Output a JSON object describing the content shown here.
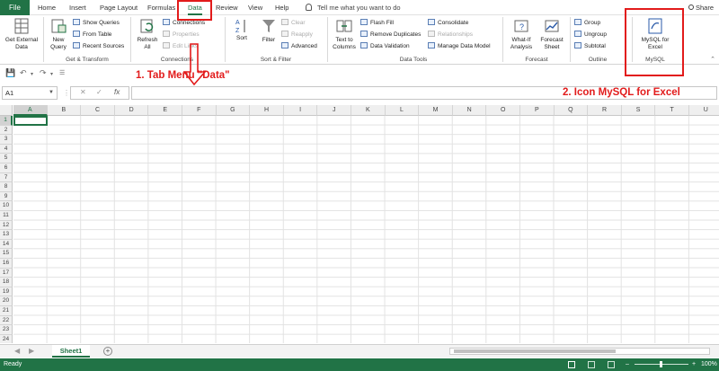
{
  "menu": {
    "file": "File",
    "tabs": [
      "Home",
      "Insert",
      "Page Layout",
      "Formulas",
      "Data",
      "Review",
      "View",
      "Help"
    ],
    "active_tab": "Data",
    "tell_me": "Tell me what you want to do",
    "share": "Share"
  },
  "ribbon": {
    "get_transform": {
      "get_external_data": "Get External Data",
      "new_query": "New Query",
      "show_queries": "Show Queries",
      "from_table": "From Table",
      "recent_sources": "Recent Sources",
      "label": "Get & Transform"
    },
    "connections": {
      "refresh_all": "Refresh All",
      "connections": "Connections",
      "properties": "Properties",
      "edit_links": "Edit Links",
      "label": "Connections"
    },
    "sort_filter": {
      "sort": "Sort",
      "filter": "Filter",
      "clear": "Clear",
      "reapply": "Reapply",
      "advanced": "Advanced",
      "label": "Sort & Filter"
    },
    "data_tools": {
      "text_to_columns": "Text to Columns",
      "flash_fill": "Flash Fill",
      "remove_duplicates": "Remove Duplicates",
      "data_validation": "Data Validation",
      "consolidate": "Consolidate",
      "relationships": "Relationships",
      "manage_data_model": "Manage Data Model",
      "label": "Data Tools"
    },
    "forecast": {
      "what_if": "What-If Analysis",
      "forecast_sheet": "Forecast Sheet",
      "label": "Forecast"
    },
    "outline": {
      "group": "Group",
      "ungroup": "Ungroup",
      "subtotal": "Subtotal",
      "label": "Outline"
    },
    "mysql": {
      "button": "MySQL for Excel",
      "label": "MySQL"
    }
  },
  "formula_bar": {
    "name_box": "A1",
    "fx": "fx"
  },
  "grid": {
    "columns": [
      "A",
      "B",
      "C",
      "D",
      "E",
      "F",
      "G",
      "H",
      "I",
      "J",
      "K",
      "L",
      "M",
      "N",
      "O",
      "P",
      "Q",
      "R",
      "S",
      "T",
      "U"
    ],
    "rows": [
      "1",
      "2",
      "3",
      "4",
      "5",
      "6",
      "7",
      "8",
      "9",
      "10",
      "11",
      "12",
      "13",
      "14",
      "15",
      "16",
      "17",
      "18",
      "19",
      "20",
      "21",
      "22",
      "23",
      "24"
    ],
    "active_cell": "A1"
  },
  "sheets": {
    "tabs": [
      "Sheet1"
    ],
    "add": "+"
  },
  "status": {
    "ready": "Ready",
    "zoom": "100%"
  },
  "annotations": {
    "tab_menu": "1. Tab Menu \"Data\"",
    "icon_mysql": "2. Icon MySQL for Excel"
  },
  "colors": {
    "excel_green": "#217346",
    "annotation_red": "#e21b1b"
  }
}
